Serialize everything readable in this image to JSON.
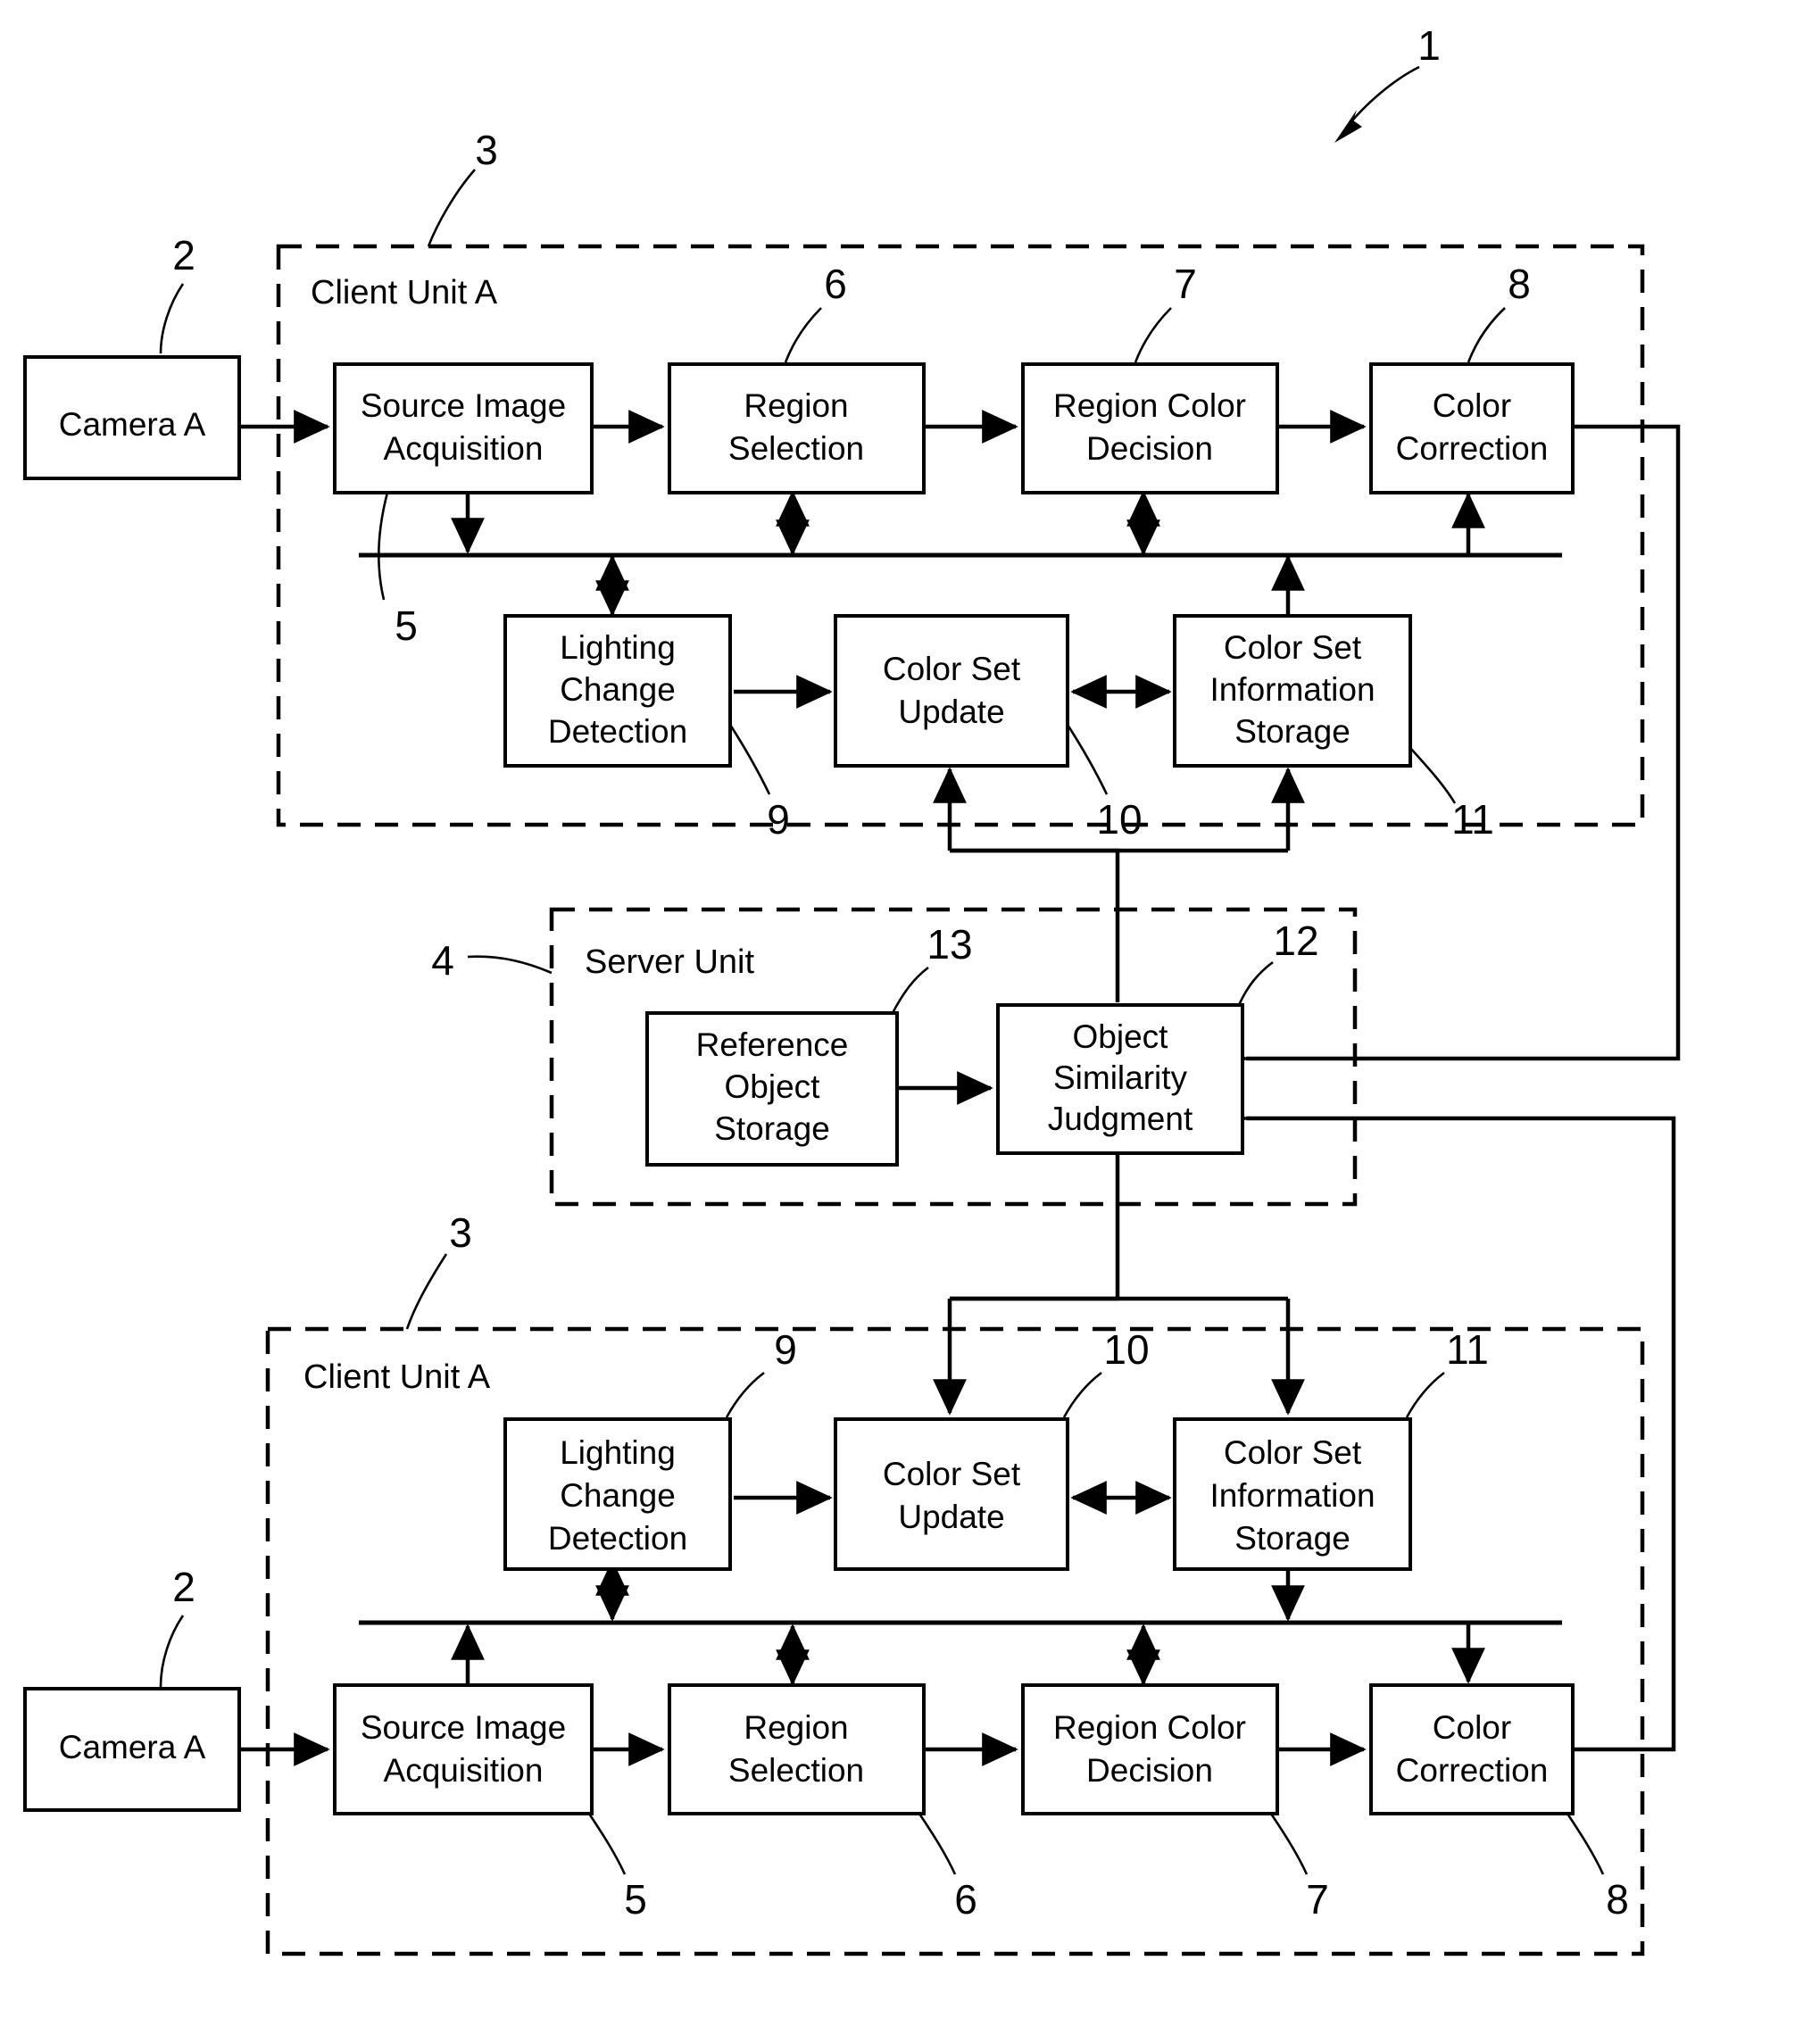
{
  "figure": {
    "type": "patent-block-diagram",
    "system_reference": "1",
    "background": "#ffffff",
    "line_color": "#000000"
  },
  "units": [
    {
      "id": "client-top",
      "label": "Client Unit A",
      "reference": "3"
    },
    {
      "id": "server",
      "label": "Server Unit",
      "reference": "4"
    },
    {
      "id": "client-bottom",
      "label": "Client Unit A",
      "reference": "3"
    }
  ],
  "blocks": {
    "camera_top": {
      "label": "Camera A",
      "reference": "2"
    },
    "camera_bottom": {
      "label": "Camera A",
      "reference": "2"
    },
    "source_image_acquisition_top": {
      "label": "Source Image Acquisition",
      "line1": "Source Image",
      "line2": "Acquisition",
      "reference": "5"
    },
    "region_selection_top": {
      "label": "Region Selection",
      "line1": "Region",
      "line2": "Selection",
      "reference": "6"
    },
    "region_color_decision_top": {
      "label": "Region Color Decision",
      "line1": "Region Color",
      "line2": "Decision",
      "reference": "7"
    },
    "color_correction_top": {
      "label": "Color Correction",
      "line1": "Color",
      "line2": "Correction",
      "reference": "8"
    },
    "lighting_change_detection_top": {
      "label": "Lighting Change Detection",
      "line1": "Lighting",
      "line2": "Change",
      "line3": "Detection",
      "reference": "9"
    },
    "color_set_update_top": {
      "label": "Color Set Update",
      "line1": "Color Set",
      "line2": "Update",
      "reference": "10"
    },
    "color_set_information_storage_top": {
      "label": "Color Set Information Storage",
      "line1": "Color Set",
      "line2": "Information",
      "line3": "Storage",
      "reference": "11"
    },
    "reference_object_storage": {
      "label": "Reference Object Storage",
      "line1": "Reference",
      "line2": "Object",
      "line3": "Storage",
      "reference": "13"
    },
    "object_similarity_judgment": {
      "label": "Object Similarity Judgment",
      "line1": "Object",
      "line2": "Similarity",
      "line3": "Judgment",
      "reference": "12"
    },
    "lighting_change_detection_bottom": {
      "label": "Lighting Change Detection",
      "line1": "Lighting",
      "line2": "Change",
      "line3": "Detection",
      "reference": "9"
    },
    "color_set_update_bottom": {
      "label": "Color Set Update",
      "line1": "Color Set",
      "line2": "Update",
      "reference": "10"
    },
    "color_set_information_storage_bottom": {
      "label": "Color Set Information Storage",
      "line1": "Color Set",
      "line2": "Information",
      "line3": "Storage",
      "reference": "11"
    },
    "source_image_acquisition_bottom": {
      "label": "Source Image Acquisition",
      "line1": "Source Image",
      "line2": "Acquisition",
      "reference": "5"
    },
    "region_selection_bottom": {
      "label": "Region Selection",
      "line1": "Region",
      "line2": "Selection",
      "reference": "6"
    },
    "region_color_decision_bottom": {
      "label": "Region Color Decision",
      "line1": "Region Color",
      "line2": "Decision",
      "reference": "7"
    },
    "color_correction_bottom": {
      "label": "Color Correction",
      "line1": "Color",
      "line2": "Correction",
      "reference": "8"
    }
  },
  "reference_numerals": {
    "system": "1",
    "camera_top": "2",
    "client_top": "3",
    "server": "4",
    "source_image_top": "5",
    "region_selection_top": "6",
    "region_color_top": "7",
    "color_correction_top": "8",
    "lighting_top": "9",
    "color_set_update_top": "10",
    "color_set_storage_top": "11",
    "object_similarity": "12",
    "reference_object_storage": "13",
    "client_bottom": "3",
    "lighting_bottom": "9",
    "color_set_update_bottom": "10",
    "color_set_storage_bottom": "11",
    "camera_bottom": "2",
    "source_image_bottom": "5",
    "region_selection_bottom": "6",
    "region_color_bottom": "7",
    "color_correction_bottom": "8"
  }
}
